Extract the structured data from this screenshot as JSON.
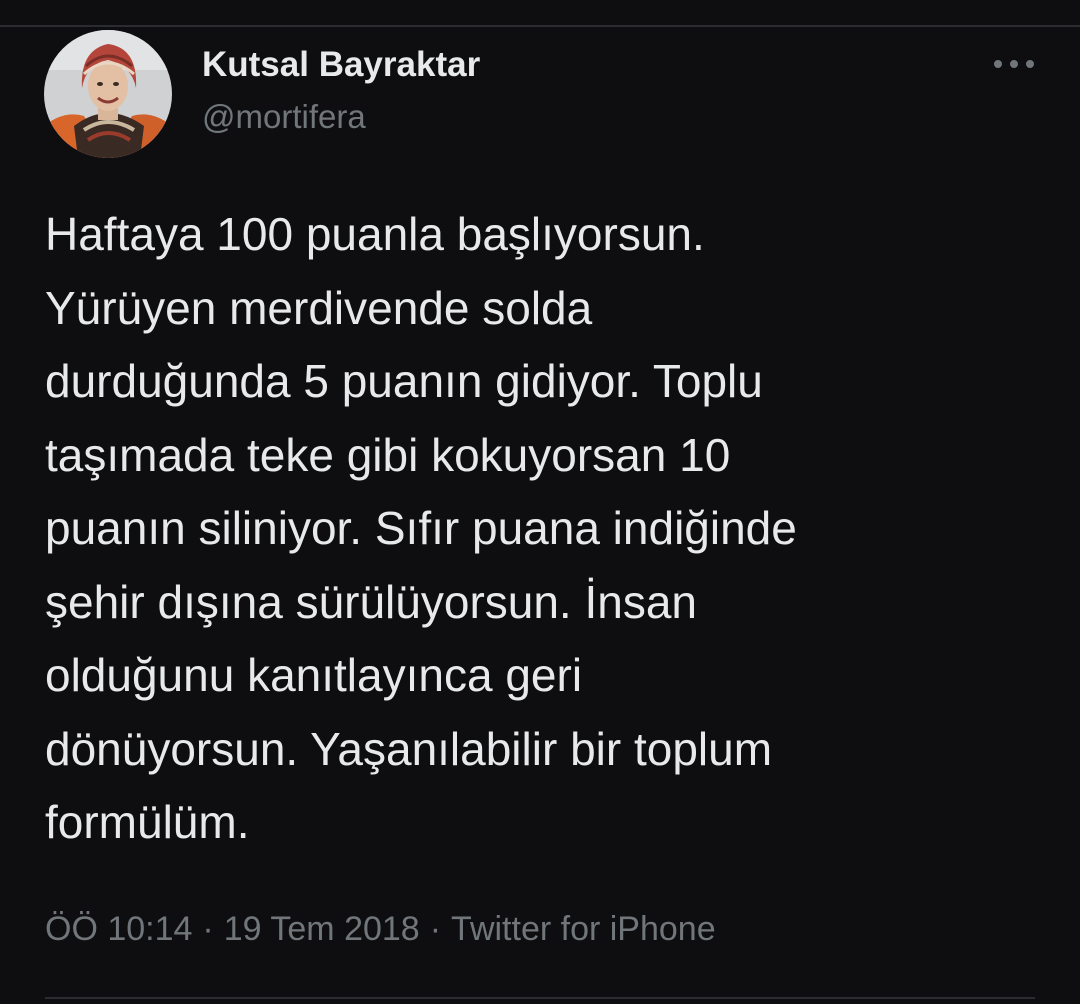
{
  "tweet": {
    "author": {
      "display_name": "Kutsal Bayraktar",
      "handle": "@mortifera",
      "avatar_icon": "profile-photo"
    },
    "more_icon": "more-horizontal-icon",
    "text": "Haftaya 100 puanla başlıyorsun.\nYürüyen merdivende solda\ndurduğunda 5 puanın gidiyor. Toplu\ntaşımada teke gibi kokuyorsan 10\npuanın siliniyor. Sıfır puana indiğinde\nşehir dışına sürülüyorsun. İnsan\nolduğunu kanıtlayınca geri\ndönüyorsun. Yaşanılabilir bir toplum\nformülüm.",
    "meta": {
      "time": "ÖÖ 10:14",
      "separator": "·",
      "date": "19 Tem 2018",
      "source": "Twitter for iPhone"
    }
  },
  "colors": {
    "background": "#0e0e10",
    "primary_text": "#e7e9ea",
    "secondary_text": "#71767b",
    "divider": "#2a2c2f"
  }
}
